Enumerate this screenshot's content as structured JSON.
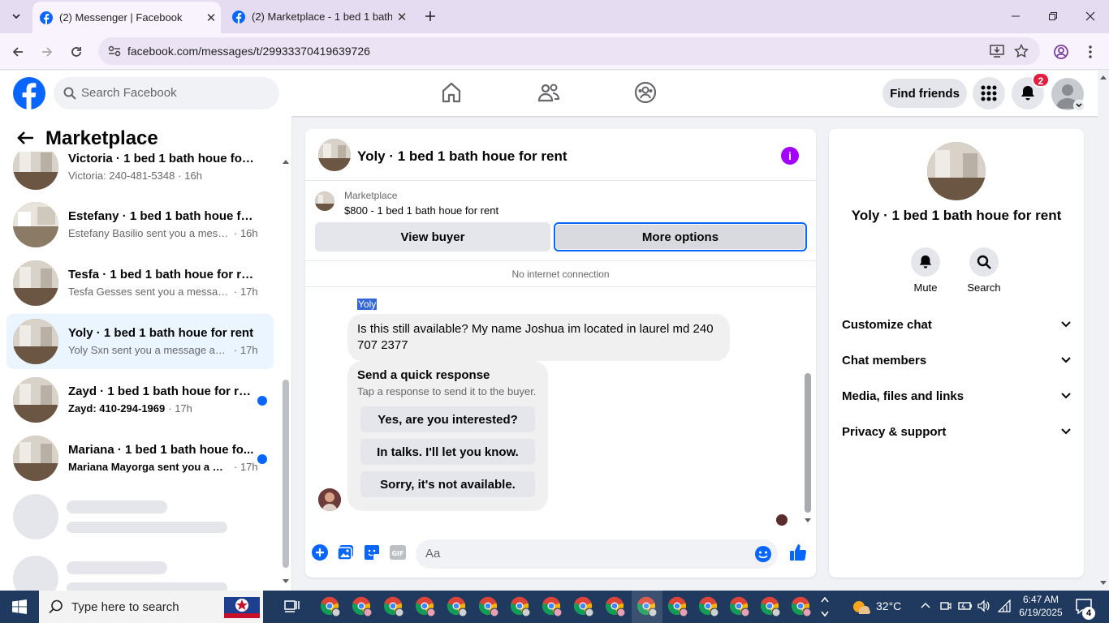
{
  "browser": {
    "tabs": [
      {
        "title": "(2) Messenger | Facebook",
        "active": true
      },
      {
        "title": "(2) Marketplace - 1 bed 1 bath h",
        "active": false
      }
    ],
    "url": "facebook.com/messages/t/29933370419639726"
  },
  "fb": {
    "search_placeholder": "Search Facebook",
    "find_friends": "Find friends",
    "notification_count": "2"
  },
  "left": {
    "title": "Marketplace",
    "conversations": [
      {
        "title": "Victoria · 1 bed 1 bath houe for r...",
        "preview": "Victoria: 240-481-5348",
        "time": "· 16h",
        "unread": false
      },
      {
        "title": "Estefany · 1 bed 1 bath houe for ...",
        "preview": "Estefany Basilio sent you a messa...",
        "time": "· 16h",
        "unread": false
      },
      {
        "title": "Tesfa · 1 bed 1 bath houe for rent",
        "preview": "Tesfa Gesses sent you a message ...",
        "time": "· 17h",
        "unread": false
      },
      {
        "title": "Yoly · 1 bed 1 bath houe for rent",
        "preview": "Yoly Sxn sent you a message abou...",
        "time": "· 17h",
        "unread": false,
        "selected": true
      },
      {
        "title": "Zayd · 1 bed 1 bath houe for rent",
        "preview": "Zayd: 410-294-1969",
        "time": "· 17h",
        "unread": true
      },
      {
        "title": "Mariana · 1 bed 1 bath houe fo...",
        "preview": "Mariana Mayorga sent you a m...",
        "time": "· 17h",
        "unread": true
      }
    ]
  },
  "chat": {
    "title": "Yoly · 1 bed 1 bath houe for rent",
    "marketplace_label": "Marketplace",
    "listing": "$800 - 1 bed 1 bath houe for rent",
    "view_buyer": "View buyer",
    "more_options": "More options",
    "status": "No internet connection",
    "sender": "Yoly",
    "message": "Is this still available? My name Joshua im located in laurel md 240 707 2377",
    "quick_title": "Send a quick response",
    "quick_subtitle": "Tap a response to send it to the buyer.",
    "quick_responses": [
      "Yes, are you interested?",
      "In talks. I'll let you know.",
      "Sorry, it's not available."
    ],
    "composer_placeholder": "Aa"
  },
  "right": {
    "name": "Yoly · 1 bed 1 bath houe for rent",
    "actions": [
      "Mute",
      "Search"
    ],
    "sections": [
      "Customize chat",
      "Chat members",
      "Media, files and links",
      "Privacy & support"
    ]
  },
  "taskbar": {
    "search_placeholder": "Type here to search",
    "weather": "32°C",
    "time": "6:47 AM",
    "date": "6/19/2025",
    "notifications": "4"
  },
  "colors": {
    "fb_blue": "#0866ff",
    "info_purple": "#a200ff",
    "unread_dot": "#0866ff"
  }
}
